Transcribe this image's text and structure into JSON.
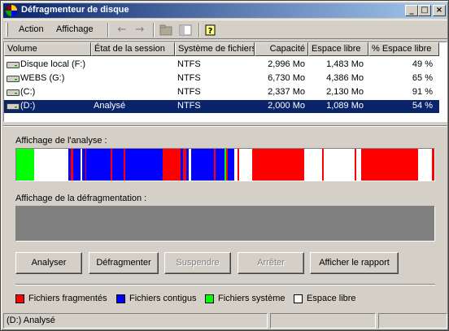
{
  "window": {
    "title": "Défragmenteur de disque"
  },
  "menu": {
    "action": "Action",
    "view": "Affichage"
  },
  "columns": [
    "Volume",
    "État de la session",
    "Système de fichiers",
    "Capacité",
    "Espace libre",
    "% Espace libre"
  ],
  "volumes": [
    {
      "name": "Disque local (F:)",
      "status": "",
      "fs": "NTFS",
      "capacity": "2,996 Mo",
      "free": "1,483 Mo",
      "pct": "49 %"
    },
    {
      "name": "WEBS (G:)",
      "status": "",
      "fs": "NTFS",
      "capacity": "6,730 Mo",
      "free": "4,386 Mo",
      "pct": "65 %"
    },
    {
      "name": "(C:)",
      "status": "",
      "fs": "NTFS",
      "capacity": "2,337 Mo",
      "free": "2,130 Mo",
      "pct": "91 %"
    },
    {
      "name": "(D:)",
      "status": "Analysé",
      "fs": "NTFS",
      "capacity": "2,000 Mo",
      "free": "1,089 Mo",
      "pct": "54 %"
    }
  ],
  "selected_volume": 3,
  "analysis_label": "Affichage de l'analyse :",
  "defrag_label": "Affichage de la défragmentation :",
  "buttons": {
    "analyze": "Analyser",
    "defragment": "Défragmenter",
    "pause": "Suspendre",
    "stop": "Arrêter",
    "report": "Afficher le rapport"
  },
  "legend": [
    {
      "label": "Fichiers fragmentés",
      "color": "#ff0000"
    },
    {
      "label": "Fichiers contigus",
      "color": "#0000ff"
    },
    {
      "label": "Fichiers système",
      "color": "#00ff00"
    },
    {
      "label": "Espace libre",
      "color": "#ffffff"
    }
  ],
  "analysis_map_colors": {
    "fragmented": "#ff0000",
    "contiguous": "#0000ff",
    "system": "#00ff00",
    "free": "#ffffff"
  },
  "status_text": "(D:) Analysé"
}
